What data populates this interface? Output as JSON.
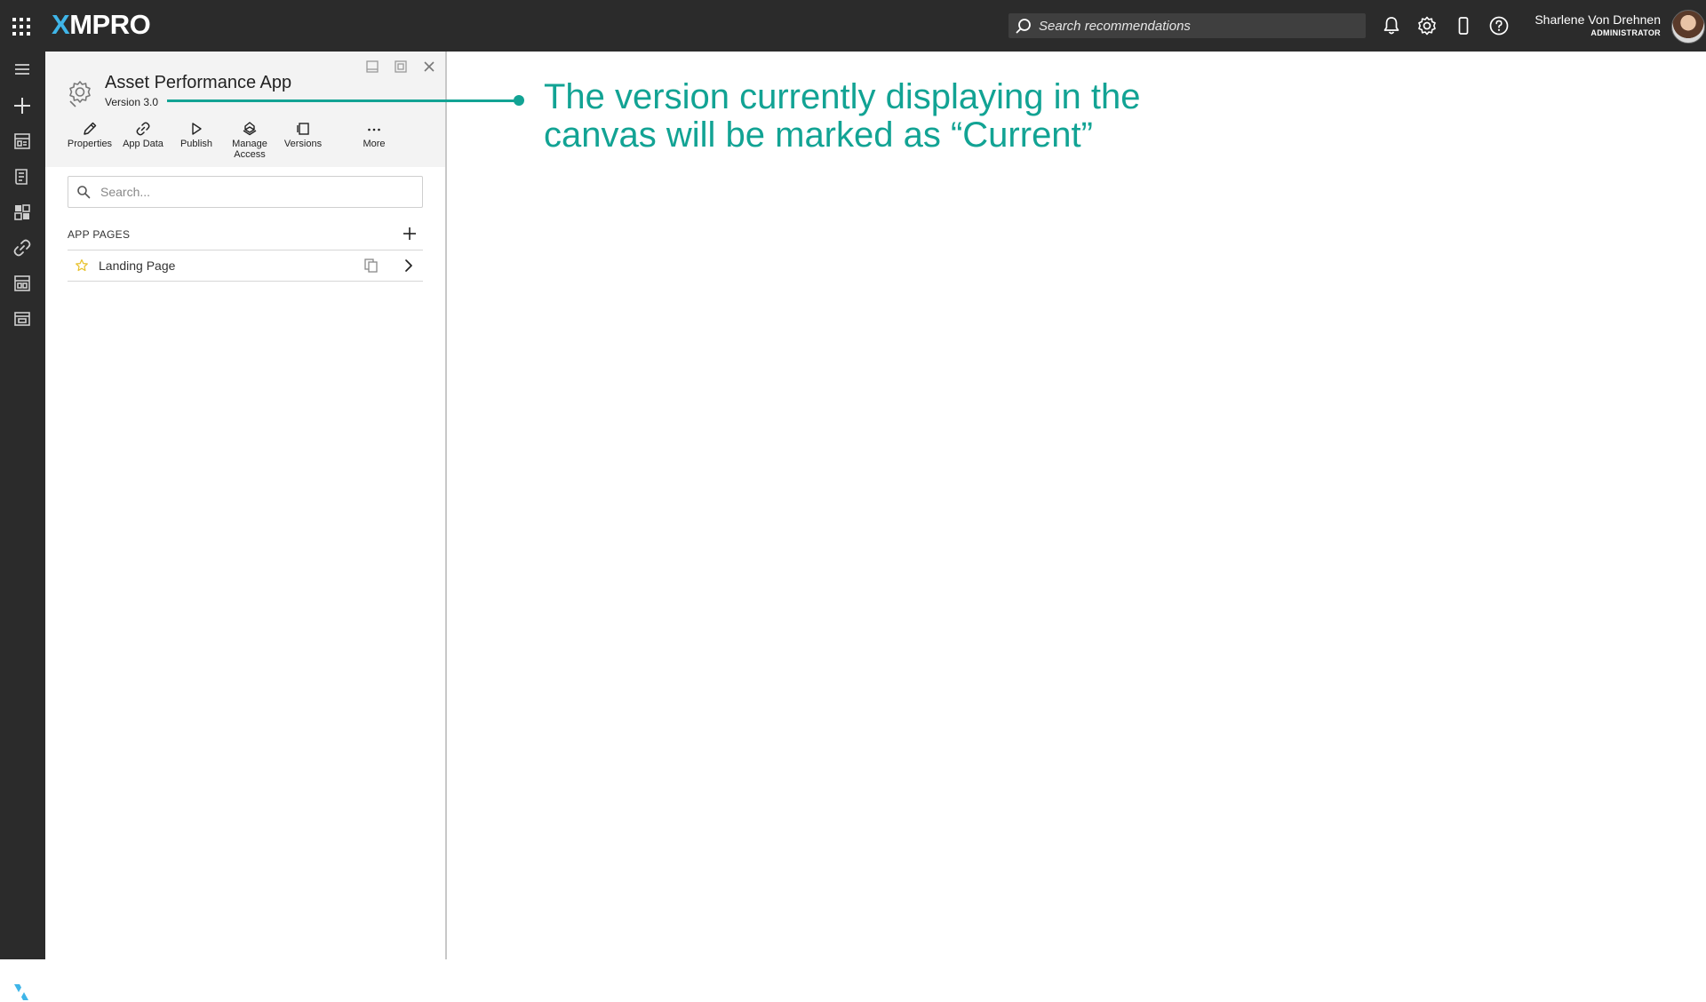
{
  "topbar": {
    "logo_x": "X",
    "logo_rest": "MPRO",
    "search_placeholder": "Search recommendations",
    "icons": [
      "apps-grid-icon",
      "bell-icon",
      "gear-icon",
      "mobile-device-icon",
      "help-icon"
    ],
    "user": {
      "name": "Sharlene Von Drehnen",
      "role": "ADMINISTRATOR"
    }
  },
  "rail": {
    "icons": [
      "menu-icon",
      "plus-icon",
      "app-builder-icon",
      "data-stream-icon",
      "dashboard-icon",
      "link-icon",
      "recommendation-icon",
      "view-icon",
      "xmpro-logo-icon"
    ]
  },
  "panel": {
    "app_title": "Asset Performance App",
    "version": "Version 3.0",
    "toolbar": [
      {
        "label": "Properties",
        "icon": "pencil-icon"
      },
      {
        "label": "App Data",
        "icon": "link-icon"
      },
      {
        "label": "Publish",
        "icon": "play-icon"
      },
      {
        "label": "Manage Access",
        "icon": "access-icon"
      },
      {
        "label": "Versions",
        "icon": "versions-icon"
      },
      {
        "label": "More",
        "icon": "ellipsis-icon"
      }
    ],
    "search_placeholder": "Search...",
    "pages_section": "APP PAGES",
    "pages": [
      {
        "label": "Landing Page",
        "icon": "star-icon"
      }
    ]
  },
  "annotation": {
    "text": "The version currently displaying in the canvas will be marked as “Current”",
    "color": "#12a394"
  },
  "colors": {
    "chrome": "#2b2b2b",
    "accent": "#12a394",
    "logo_accent": "#3fb5e8"
  }
}
